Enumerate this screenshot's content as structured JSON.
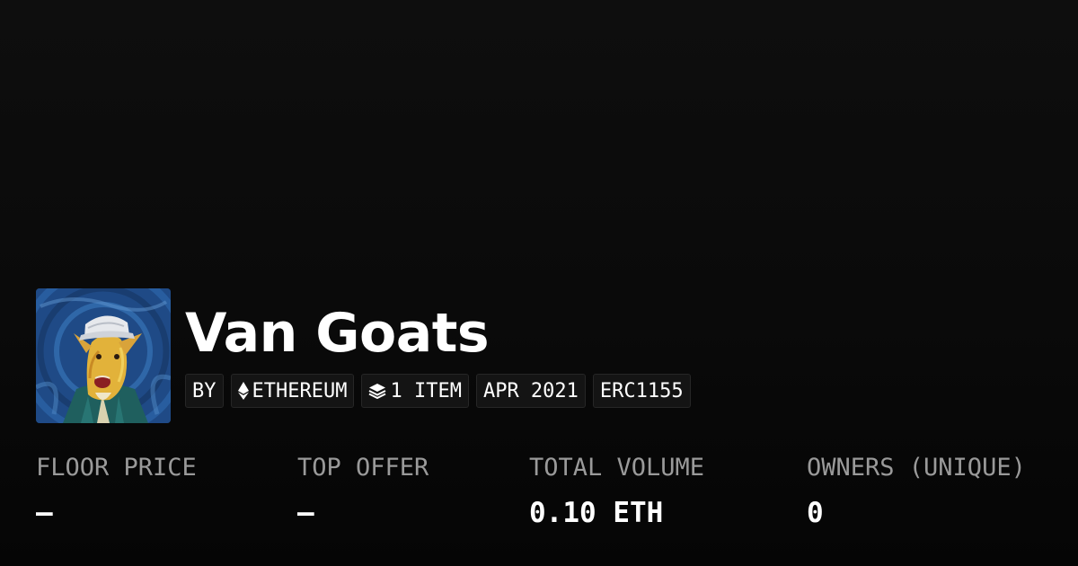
{
  "collection": {
    "name": "Van Goats",
    "avatar_icon": "van-goats-avatar-painting"
  },
  "tags": {
    "creator_prefix": "BY",
    "chain": "ETHEREUM",
    "chain_icon": "ethereum-icon",
    "items": "1 ITEM",
    "items_icon": "layers-icon",
    "date": "APR 2021",
    "standard": "ERC1155"
  },
  "stats": {
    "floor_price": {
      "label": "FLOOR PRICE",
      "value": "–"
    },
    "top_offer": {
      "label": "TOP OFFER",
      "value": "–"
    },
    "total_volume": {
      "label": "TOTAL VOLUME",
      "value": "0.10 ETH"
    },
    "owners": {
      "label": "OWNERS (UNIQUE)",
      "value": "0"
    }
  },
  "colors": {
    "background": "#0a0a0a",
    "tag_background": "#141414",
    "label_gray": "#9a9a9a",
    "text": "#ffffff"
  }
}
